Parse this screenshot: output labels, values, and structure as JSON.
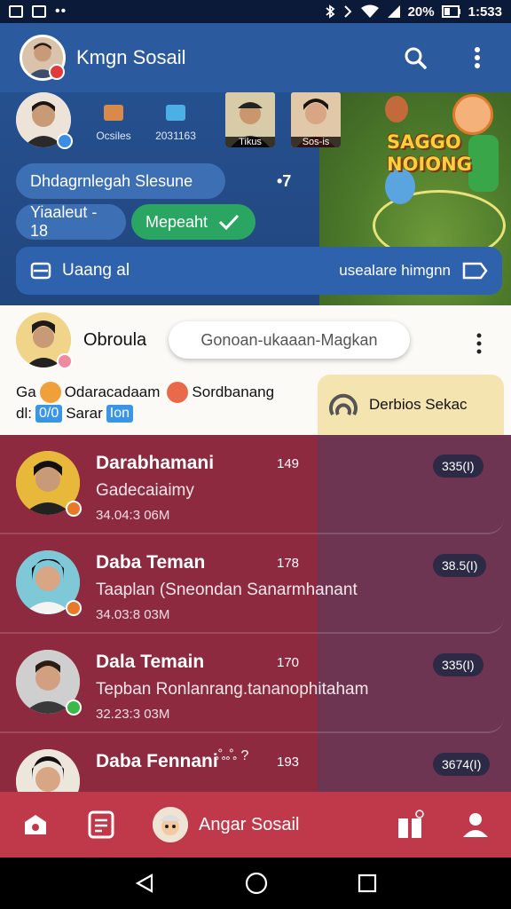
{
  "status_bar": {
    "battery": "20%",
    "time": "1:533"
  },
  "app_bar": {
    "title": "Kmgn Sosail",
    "icons": [
      "search-icon",
      "more-vert-icon"
    ]
  },
  "stories": {
    "stat_1": "Ocsiles",
    "stat_2": "2031163",
    "thumb_1_label": "Tikus",
    "thumb_2_label": "Sos-is",
    "game_title_line1": "SAGGO",
    "game_title_line2": "NOIONG",
    "loading_text": "•7",
    "pill_main": "Dhdagrnlegah Slesune",
    "pill_secondary": "Yiaaleut - 18",
    "pill_green": "Mepeaht",
    "banner_label": "Uaang al",
    "banner_right": "usealare himgnn"
  },
  "profile": {
    "name": "Obroula",
    "search_placeholder": "Gonoan-ukaaan-Magkan",
    "line1_a": "Ga",
    "line1_b": "Odaracadaam",
    "line1_c": "Sordbanang",
    "line2_a": "dl:",
    "line2_chip1": "0/0",
    "line2_b": "Sarar",
    "line2_chip2": "Ion",
    "card_label": "Derbios Sekac"
  },
  "chat_list": [
    {
      "name": "Darabhamani",
      "num": "149",
      "message": "Gadecaiaimy",
      "time": "34.04:3 06M",
      "badge": "335(I)",
      "status": "orange"
    },
    {
      "name": "Daba Teman",
      "num": "178",
      "message": "Taaplan (Sneondan Sanarmhanant",
      "time": "34.03:8 03M",
      "badge": "38.5(I)",
      "status": "orange"
    },
    {
      "name": "Dala Temain",
      "num": "170",
      "message": "Tepban Ronlanrang.tananophitaham",
      "time": "32.23:3 03M",
      "badge": "335(I)",
      "status": "green"
    },
    {
      "name": "Daba Fennani",
      "extra": "ஃஃ ?",
      "num": "193",
      "message": "",
      "time": "",
      "badge": "3674(I)",
      "status": "none"
    }
  ],
  "bottom_nav": {
    "center_label": "Angar Sosail",
    "icons": [
      "home-icon",
      "document-icon",
      "gift-icon",
      "profile-icon"
    ]
  },
  "colors": {
    "app_bar": "#2c5a9e",
    "list_bg": "#8d2a3f",
    "bottom_nav": "#c0394a",
    "accent_green": "#2aa662"
  }
}
